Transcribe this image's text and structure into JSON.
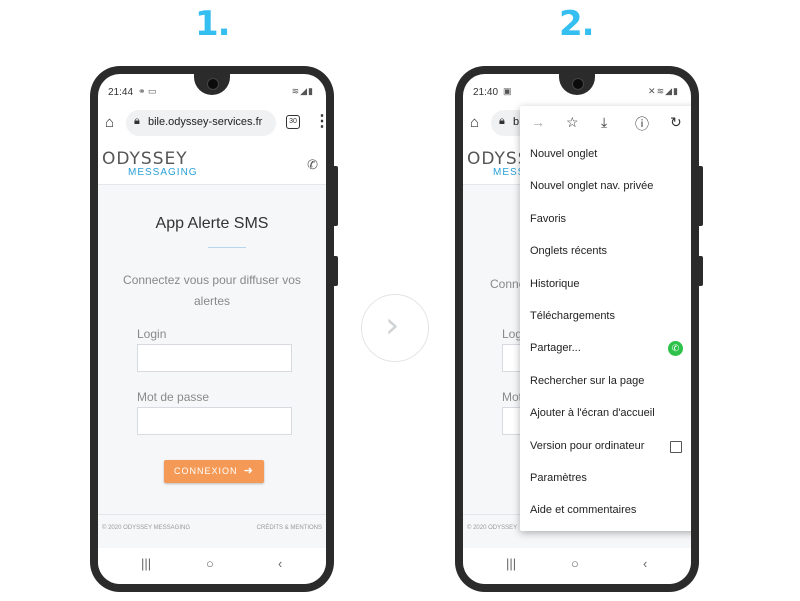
{
  "steps": {
    "one": "1.",
    "two": "2."
  },
  "phone1": {
    "status_time": "21:44",
    "status_icons": "⚭ ▭",
    "status_right": "≋◢▮",
    "url_text": "bile.odyssey-services.fr",
    "tab_count": "30",
    "site": {
      "logo": "ODYSSEY",
      "logo_sub": "MESSAGING"
    },
    "app_title": "App Alerte SMS",
    "description": "Connectez vous pour diffuser vos alertes",
    "login_label": "Login",
    "password_label": "Mot de passe",
    "button_label": "CONNEXION",
    "footer_left": "© 2020 ODYSSEY MESSAGING",
    "footer_right": "CRÉDITS & MENTIONS"
  },
  "phone2": {
    "status_time": "21:40",
    "status_icons": "▣",
    "status_right": "✕≋◢▮",
    "url_text": "b",
    "site": {
      "logo": "ODYSSEY",
      "logo_sub": "MESS"
    },
    "desc_partial": "Conne",
    "login_partial": "Logi",
    "password_partial": "Mot",
    "footer_left": "© 2020 ODYSSEY",
    "menu_items": [
      "Nouvel onglet",
      "Nouvel onglet nav. privée",
      "Favoris",
      "Onglets récents",
      "Historique",
      "Téléchargements",
      "Partager...",
      "Rechercher sur la page",
      "Ajouter à l'écran d'accueil",
      "Version pour ordinateur",
      "Paramètres",
      "Aide et commentaires"
    ]
  },
  "icons": {
    "home": "home-icon",
    "lock": "lock-icon",
    "menu": "more-vert-icon",
    "phone": "phone-icon",
    "forward": "forward-icon",
    "star": "star-icon",
    "download": "download-icon",
    "info": "info-icon",
    "refresh": "refresh-icon",
    "whatsapp": "whatsapp-icon",
    "login_arrow": "sign-in-icon"
  },
  "colors": {
    "accent": "#35bff0",
    "button": "#f59a56",
    "logo_sub": "#2aa1d6",
    "whatsapp": "#2ec24a"
  }
}
